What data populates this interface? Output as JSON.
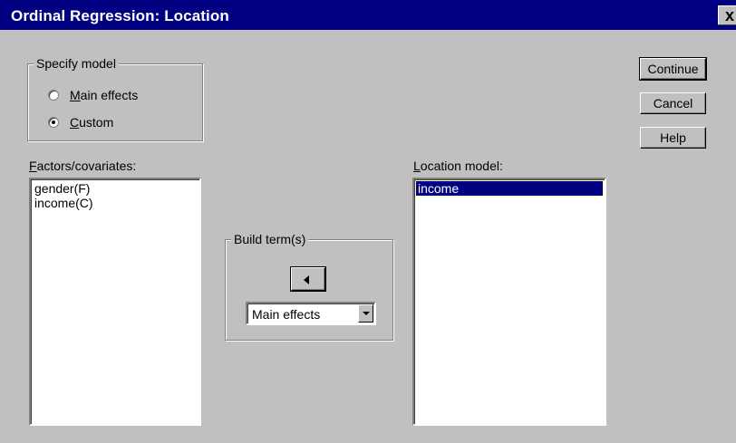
{
  "window": {
    "title": "Ordinal Regression: Location",
    "close_label": "x"
  },
  "specify_model": {
    "legend": "Specify model",
    "options": [
      {
        "label_rest": "ain effects",
        "mnemonic": "M",
        "checked": false
      },
      {
        "label_rest": "ustom",
        "mnemonic": "C",
        "checked": true
      }
    ]
  },
  "factors": {
    "label_mnemonic": "F",
    "label_rest": "actors/covariates:",
    "items": [
      "gender(F)",
      "income(C)"
    ]
  },
  "build_terms": {
    "legend": "Build term(s)",
    "type_selected": "Main effects"
  },
  "location_model": {
    "label_mnemonic": "L",
    "label_rest": "ocation model:",
    "items": [
      "income"
    ]
  },
  "buttons": {
    "continue": "Continue",
    "cancel": "Cancel",
    "help": "Help"
  },
  "icons": {
    "move_arrow": "arrow-left-icon",
    "dropdown": "chevron-down-icon"
  }
}
